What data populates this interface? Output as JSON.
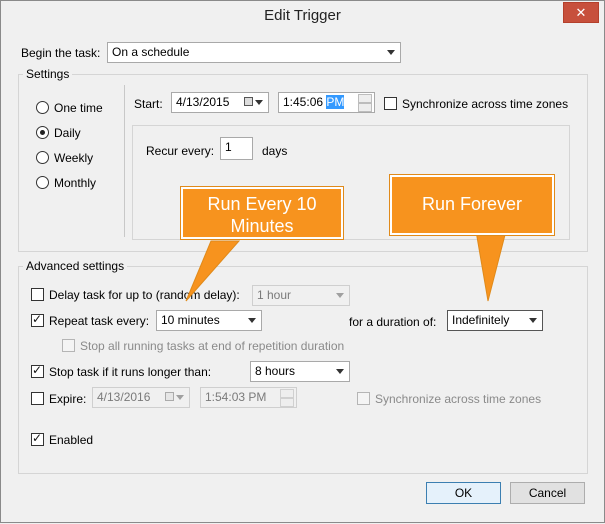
{
  "window": {
    "title": "Edit Trigger",
    "close_glyph": "✕"
  },
  "begin_task": {
    "label": "Begin the task:",
    "value": "On a schedule"
  },
  "settings": {
    "legend": "Settings",
    "radios": [
      "One time",
      "Daily",
      "Weekly",
      "Monthly"
    ],
    "selected": "Daily",
    "start_label": "Start:",
    "start_date": "4/13/2015",
    "start_time_prefix": "1:45:06 ",
    "start_time_ampm": "PM",
    "sync_label": "Synchronize across time zones",
    "recur_label": "Recur every:",
    "recur_value": "1",
    "recur_unit": "days"
  },
  "advanced": {
    "legend": "Advanced settings",
    "delay_label": "Delay task for up to (random delay):",
    "delay_value": "1 hour",
    "repeat_label": "Repeat task every:",
    "repeat_value": "10 minutes",
    "duration_label": "for a duration of:",
    "duration_value": "Indefinitely",
    "stop_running_label": "Stop all running tasks at end of repetition duration",
    "stop_longer_label": "Stop task if it runs longer than:",
    "stop_longer_value": "8 hours",
    "expire_label": "Expire:",
    "expire_date": "4/13/2016",
    "expire_time": "1:54:03 PM",
    "expire_sync_label": "Synchronize across time zones",
    "enabled_label": "Enabled"
  },
  "callouts": {
    "repeat": "Run Every 10 Minutes",
    "forever": "Run Forever"
  },
  "buttons": {
    "ok": "OK",
    "cancel": "Cancel"
  },
  "colors": {
    "callout": "#f7931e",
    "selection": "#3399ff",
    "close": "#c7503c"
  }
}
